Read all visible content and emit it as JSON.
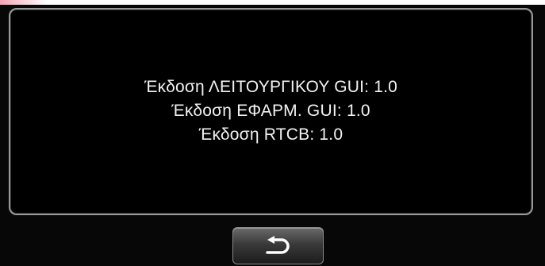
{
  "info": {
    "lines": [
      "Έκδοση ΛΕΙΤΟΥΡΓΙΚΟΥ GUI: 1.0",
      "Έκδοση ΕΦΑΡΜ. GUI: 1.0",
      "Έκδοση RTCB: 1.0"
    ]
  },
  "controls": {
    "back_icon": "return-arrow-icon"
  },
  "colors": {
    "panel_background": "#000000",
    "panel_border": "#9a9a9a",
    "text": "#f2f2f2"
  }
}
